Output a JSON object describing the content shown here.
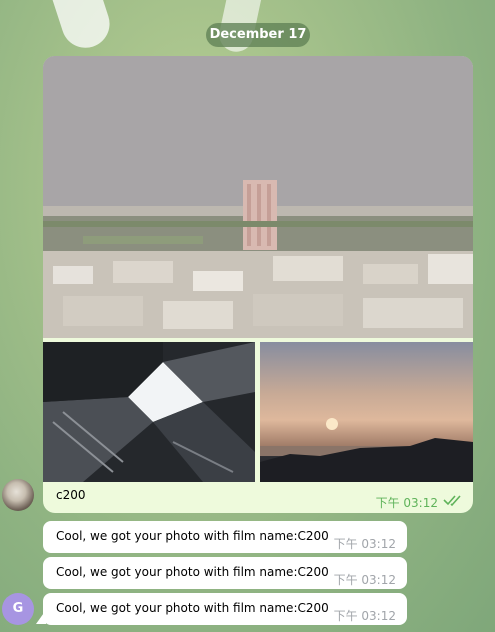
{
  "date_separator": "December 17",
  "album": {
    "caption": "c200",
    "time": "下午 03:12",
    "status": "read",
    "photos": [
      {
        "id": "cityscape"
      },
      {
        "id": "building-lookup"
      },
      {
        "id": "sunset-sea"
      }
    ]
  },
  "avatars": {
    "sender_initial": "G",
    "sender_color": "#a795e2"
  },
  "messages": [
    {
      "text": "Cool, we got your photo with film name:C200",
      "time": "下午 03:12"
    },
    {
      "text": "Cool, we got your photo with film name:C200",
      "time": "下午 03:12"
    },
    {
      "text": "Cool, we got your photo with film name:C200",
      "time": "下午 03:12"
    }
  ],
  "colors": {
    "outgoing_bubble": "#eefadc",
    "incoming_bubble": "#ffffff",
    "read_ticks": "#5fb35a",
    "date_pill": "#6f9460"
  }
}
